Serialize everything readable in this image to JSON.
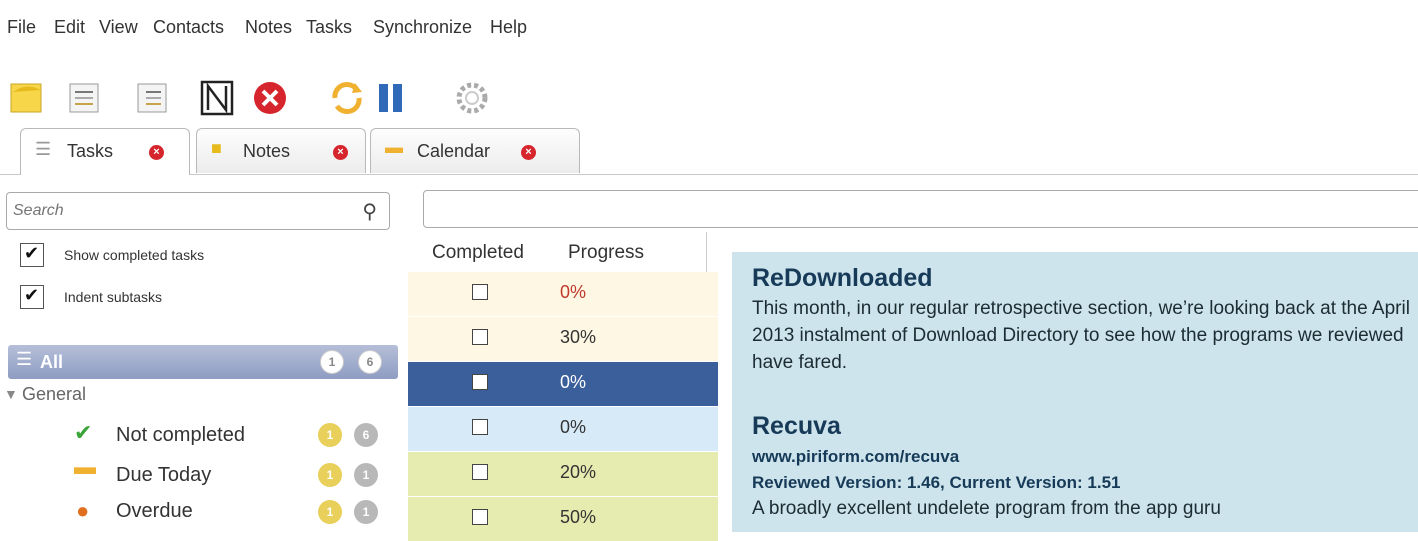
{
  "menu": [
    "File",
    "Edit",
    "View",
    "Contacts",
    "Notes",
    "Tasks",
    "Synchronize",
    "Help"
  ],
  "toolbar": {
    "icons": [
      "new-note-icon",
      "new-task-icon",
      "new-subtask-icon",
      "edit-icon",
      "delete-icon",
      "sync-icon",
      "pause-icon",
      "settings-icon"
    ]
  },
  "tabs": [
    {
      "label": "Tasks"
    },
    {
      "label": "Notes"
    },
    {
      "label": "Calendar"
    }
  ],
  "sidebar": {
    "search_placeholder": "Search",
    "show_completed": "Show completed tasks",
    "indent_subtasks": "Indent subtasks",
    "all_label": "All",
    "all_counts": [
      "1",
      "6"
    ],
    "group": "General",
    "items": [
      {
        "label": "Not completed",
        "counts": [
          "1",
          "6"
        ]
      },
      {
        "label": "Due Today",
        "counts": [
          "1",
          "1"
        ]
      },
      {
        "label": "Overdue",
        "counts": [
          "1",
          "1"
        ]
      }
    ]
  },
  "grid": {
    "headers": [
      "Completed",
      "Progress"
    ],
    "rows": [
      {
        "progress": "0%",
        "color": "#fdf7e3",
        "text_color": "#c0392b"
      },
      {
        "progress": "30%",
        "color": "#fdf7e3",
        "text_color": "#333333"
      },
      {
        "progress": "0%",
        "color": "#3a5f9a",
        "text_color": "#ffffff"
      },
      {
        "progress": "0%",
        "color": "#d6eaf7",
        "text_color": "#333333"
      },
      {
        "progress": "20%",
        "color": "#e6ecb0",
        "text_color": "#333333"
      },
      {
        "progress": "50%",
        "color": "#e6ecb0",
        "text_color": "#333333"
      }
    ]
  },
  "article": {
    "heading1": "ReDownloaded",
    "body": "This month, in our regular retrospective section, we’re looking back at the April 2013 instalment of Download Directory to see how the programs we reviewed have fared.",
    "heading2": "Recuva",
    "url": "www.piriform.com/recuva",
    "version": "Reviewed Version: 1.46, Current Version: 1.51",
    "teaser": "A broadly excellent undelete program from the app guru"
  }
}
